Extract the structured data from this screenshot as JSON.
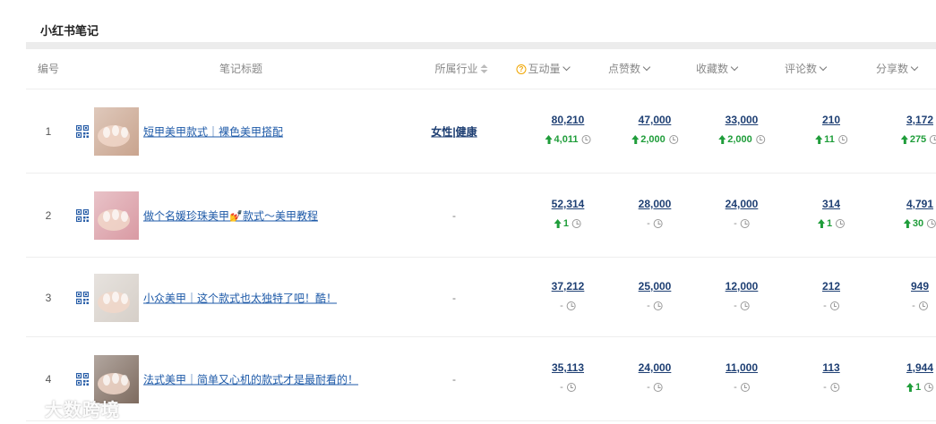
{
  "panel": {
    "title": "小红书笔记"
  },
  "columns": {
    "num": "编号",
    "title": "笔记标题",
    "industry": "所属行业",
    "interaction": "互动量",
    "likes": "点赞数",
    "collects": "收藏数",
    "comments": "评论数",
    "shares": "分享数"
  },
  "rows": [
    {
      "num": "1",
      "title": "短甲美甲款式｜裸色美甲搭配",
      "industry": [
        "女性",
        "健康"
      ],
      "thumb_color": "#c9a48e",
      "metrics": [
        {
          "value": "80,210",
          "delta": "4,011",
          "up": true
        },
        {
          "value": "47,000",
          "delta": "2,000",
          "up": true
        },
        {
          "value": "33,000",
          "delta": "2,000",
          "up": true
        },
        {
          "value": "210",
          "delta": "11",
          "up": true
        },
        {
          "value": "3,172",
          "delta": "275",
          "up": true
        }
      ]
    },
    {
      "num": "2",
      "title": "做个名媛珍珠美甲💅款式～美甲教程",
      "industry": "-",
      "thumb_color": "#d99aa3",
      "metrics": [
        {
          "value": "52,314",
          "delta": "1",
          "up": true
        },
        {
          "value": "28,000",
          "delta": "-",
          "up": false
        },
        {
          "value": "24,000",
          "delta": "-",
          "up": false
        },
        {
          "value": "314",
          "delta": "1",
          "up": true
        },
        {
          "value": "4,791",
          "delta": "30",
          "up": true
        }
      ]
    },
    {
      "num": "3",
      "title": "小众美甲｜这个款式也太独特了吧！酷！",
      "industry": "-",
      "thumb_color": "#d6cfc8",
      "metrics": [
        {
          "value": "37,212",
          "delta": "-",
          "up": false
        },
        {
          "value": "25,000",
          "delta": "-",
          "up": false
        },
        {
          "value": "12,000",
          "delta": "-",
          "up": false
        },
        {
          "value": "212",
          "delta": "-",
          "up": false
        },
        {
          "value": "949",
          "delta": "-",
          "up": false
        }
      ]
    },
    {
      "num": "4",
      "title": "法式美甲｜简单又心机的款式才是最耐看的！",
      "industry": "-",
      "thumb_color": "#7e6b5f",
      "metrics": [
        {
          "value": "35,113",
          "delta": "-",
          "up": false
        },
        {
          "value": "24,000",
          "delta": "-",
          "up": false
        },
        {
          "value": "11,000",
          "delta": "-",
          "up": false
        },
        {
          "value": "113",
          "delta": "-",
          "up": false
        },
        {
          "value": "1,944",
          "delta": "1",
          "up": true
        }
      ]
    }
  ],
  "watermark": "大数跨境"
}
